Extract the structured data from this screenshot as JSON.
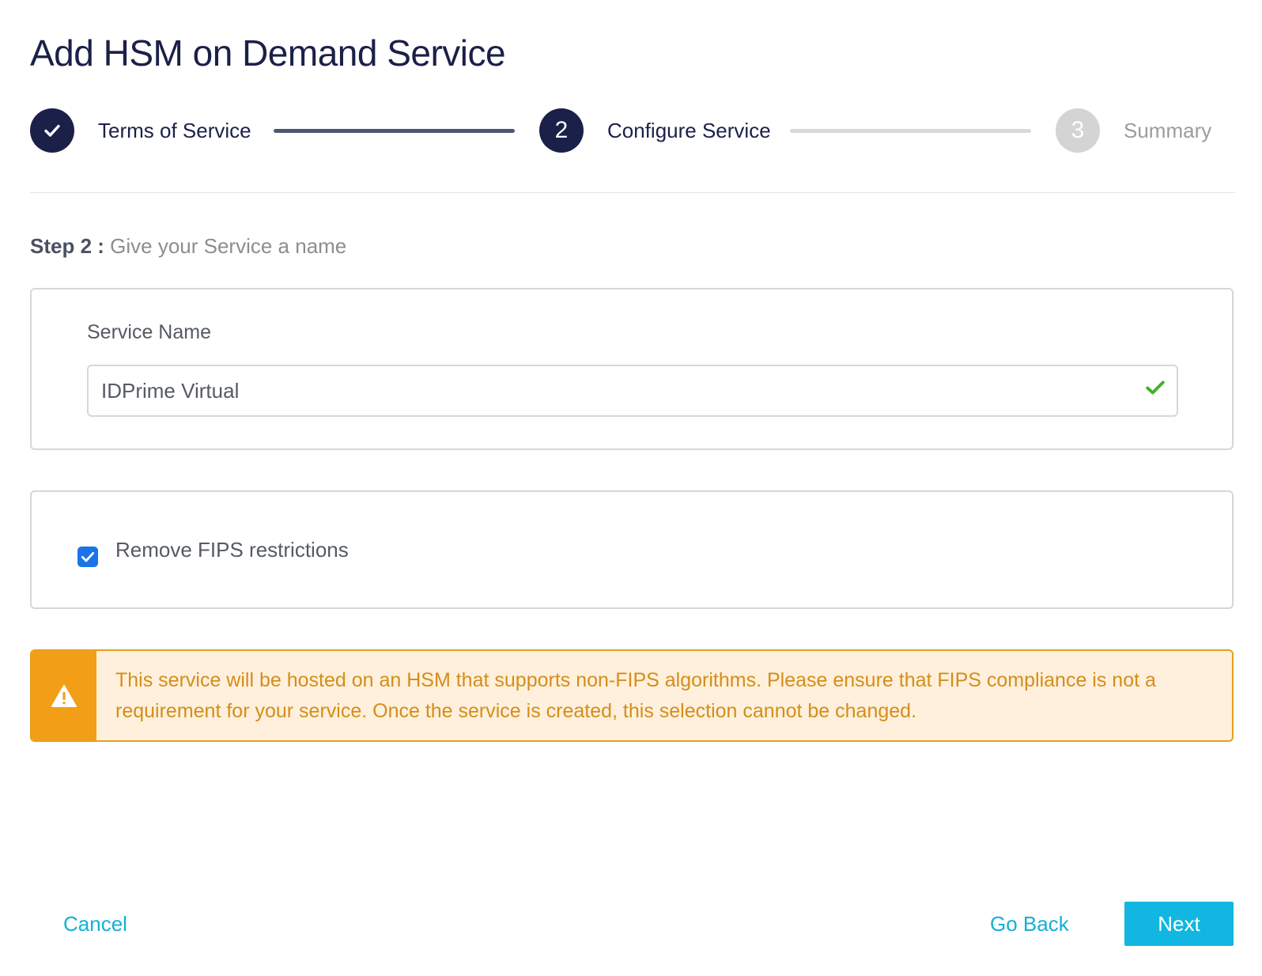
{
  "title": "Add HSM on Demand Service",
  "stepper": {
    "steps": [
      {
        "number": "1",
        "label": "Terms of Service",
        "state": "done",
        "icon": "check-icon"
      },
      {
        "number": "2",
        "label": "Configure Service",
        "state": "active"
      },
      {
        "number": "3",
        "label": "Summary",
        "state": "pending"
      }
    ]
  },
  "step_heading": {
    "prefix": "Step 2",
    "separator": " : ",
    "text": "Give your Service a name"
  },
  "service_name": {
    "label": "Service Name",
    "value": "IDPrime Virtual",
    "valid_icon": "check-icon"
  },
  "fips": {
    "checked": true,
    "label": "Remove FIPS restrictions"
  },
  "alert": {
    "icon": "warning-icon",
    "text": "This service will be hosted on an HSM that supports non-FIPS algorithms. Please ensure that FIPS compliance is not a requirement for your service. Once the service is created, this selection cannot be changed."
  },
  "footer": {
    "cancel_label": "Cancel",
    "back_label": "Go Back",
    "next_label": "Next"
  },
  "colors": {
    "primary": "#1b2049",
    "accent": "#11b7e0",
    "warning": "#f29e17",
    "success": "#43b02a"
  }
}
